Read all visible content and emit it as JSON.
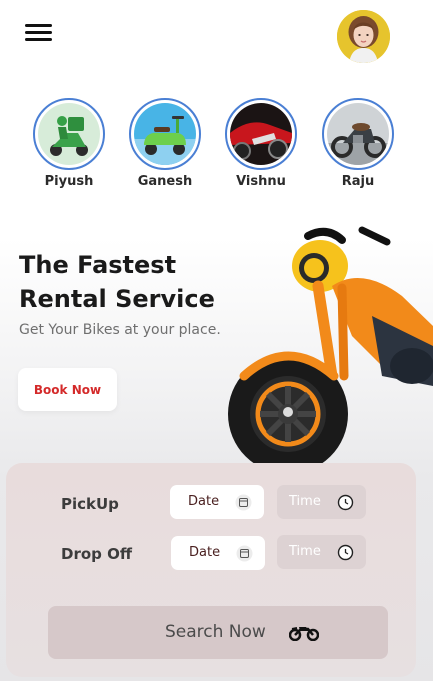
{
  "riders": [
    {
      "name": "Piyush",
      "icon": "scooter-rider-icon"
    },
    {
      "name": "Ganesh",
      "icon": "green-scooter-icon"
    },
    {
      "name": "Vishnu",
      "icon": "red-sportbike-icon"
    },
    {
      "name": "Raju",
      "icon": "classic-motorcycle-icon"
    }
  ],
  "hero": {
    "title": "The Fastest Rental Service",
    "subtitle": "Get Your Bikes at your place.",
    "book_button": "Book Now"
  },
  "booking": {
    "pickup_label": "PickUp",
    "dropoff_label": "Drop Off",
    "date_label": "Date",
    "time_label": "Time",
    "search_button": "Search Now"
  },
  "colors": {
    "accent_red": "#d42a2a",
    "story_ring": "#4a7fd4",
    "bike_orange": "#f28a1a",
    "bike_yellow": "#f6c21c"
  }
}
